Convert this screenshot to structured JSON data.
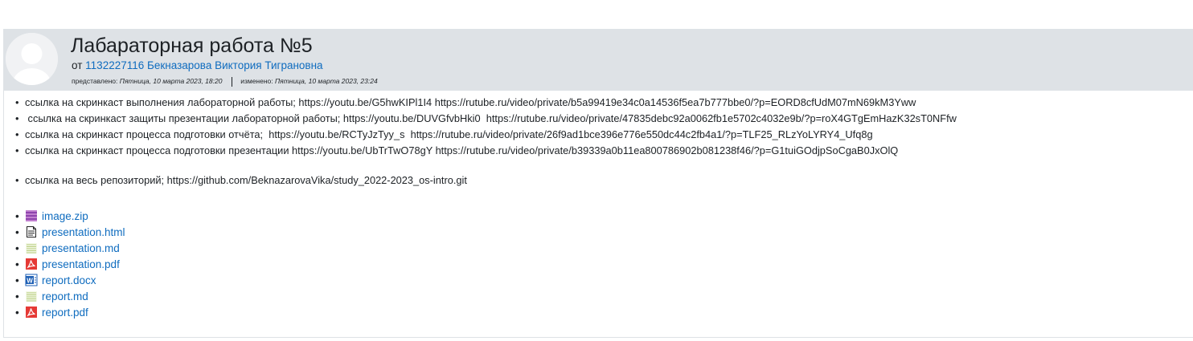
{
  "post": {
    "title": "Лабараторная работа №5",
    "by_prefix": "от",
    "author": "1132227116 Бекназарова Виктория Тиграновна",
    "submitted_label": "представлено:",
    "submitted_date": "Пятница, 10 марта 2023, 18:20",
    "modified_label": "изменено:",
    "modified_date": "Пятница, 10 марта 2023, 23:24"
  },
  "content": {
    "lines": [
      "ссылка на скринкаст выполнения лабораторной работы;  https://youtu.be/G5hwKIPl1I4 https://rutube.ru/video/private/b5a99419e34c0a14536f5ea7b777bbe0/?p=EORD8cfUdM07mN69kM3Yww",
      " ссылка на скринкаст защиты презентации лабораторной работы; https://youtu.be/DUVGfvbHki0  https://rutube.ru/video/private/47835debc92a0062fb1e5702c4032e9b/?p=roX4GTgEmHazK32sT0NFfw",
      "ссылка на скринкаст процесса подготовки отчёта;  https://youtu.be/RCTyJzTyy_s  https://rutube.ru/video/private/26f9ad1bce396e776e550dc44c2fb4a1/?p=TLF25_RLzYoLYRY4_Ufq8g",
      "ссылка на скринкаст процесса подготовки презентации https://youtu.be/UbTrTwO78gY https://rutube.ru/video/private/b39339a0b11ea800786902b081238f46/?p=G1tuiGOdjpSoCgaB0JxOlQ",
      "ссылка на весь репозиторий; https://github.com/BeknazarovaVika/study_2022-2023_os-intro.git"
    ],
    "bullet": "•"
  },
  "attachments": [
    {
      "name": "image.zip",
      "icon": "archive-icon"
    },
    {
      "name": "presentation.html",
      "icon": "html-document-icon"
    },
    {
      "name": "presentation.md",
      "icon": "text-document-icon"
    },
    {
      "name": "presentation.pdf",
      "icon": "pdf-icon"
    },
    {
      "name": "report.docx",
      "icon": "word-document-icon"
    },
    {
      "name": "report.md",
      "icon": "text-document-icon"
    },
    {
      "name": "report.pdf",
      "icon": "pdf-icon"
    }
  ],
  "colors": {
    "header_bg": "#dee2e6",
    "link": "#0f6cbf",
    "text": "#1d2125"
  }
}
